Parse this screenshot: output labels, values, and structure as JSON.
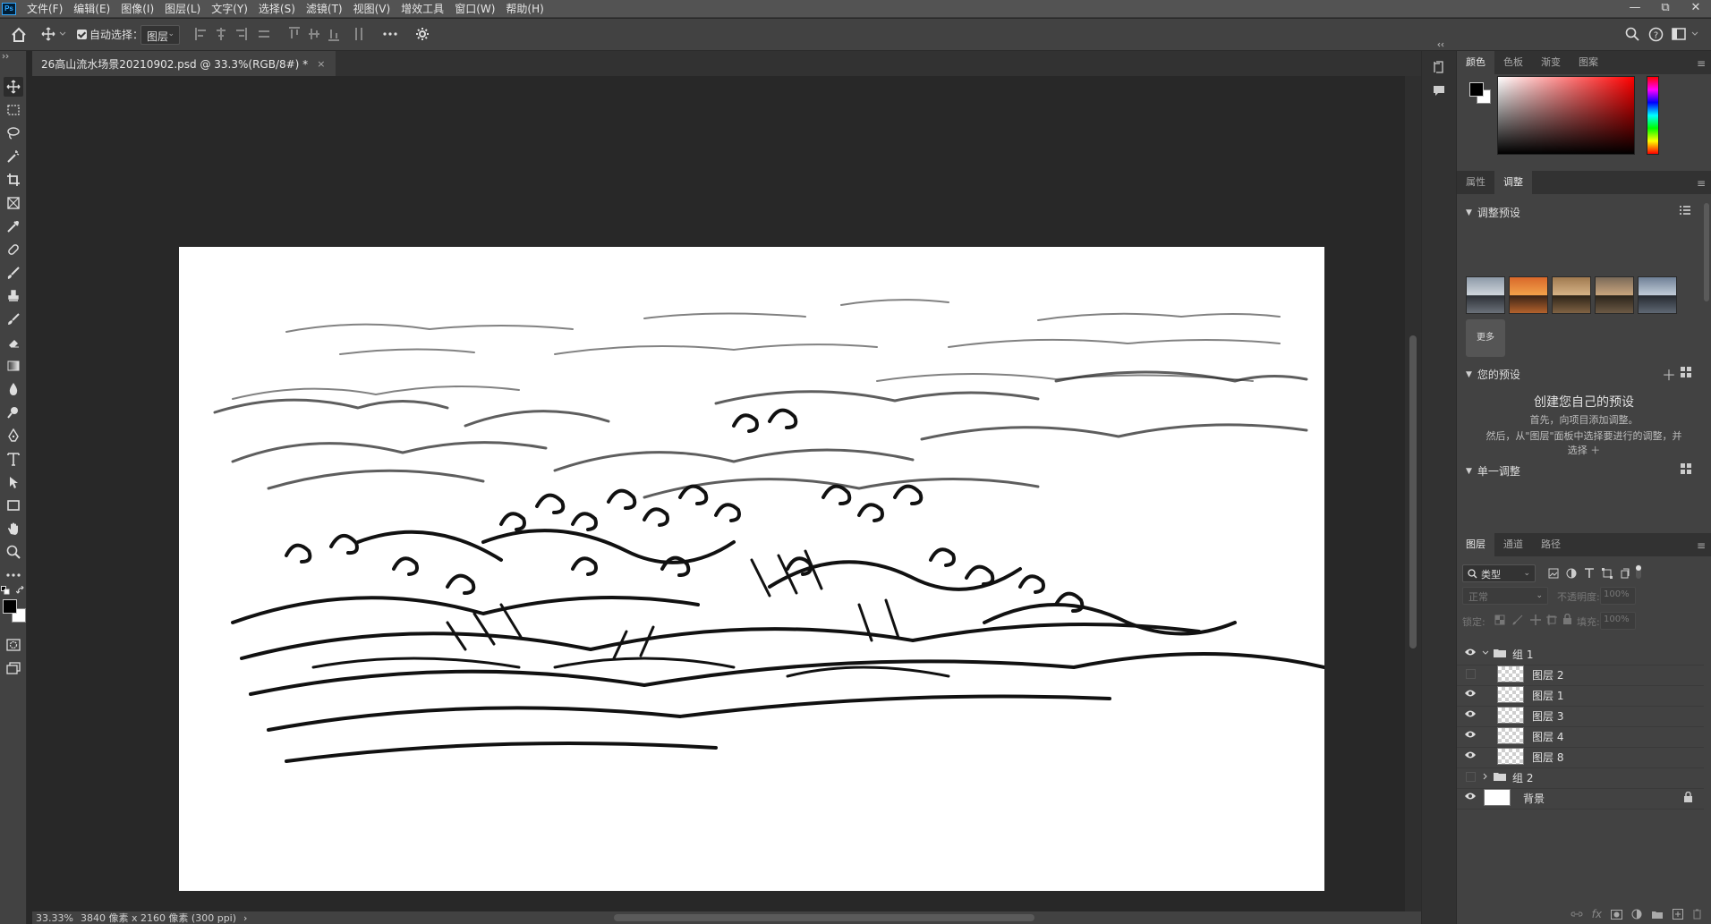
{
  "app": {
    "logo": "Ps",
    "menu": [
      "文件(F)",
      "编辑(E)",
      "图像(I)",
      "图层(L)",
      "文字(Y)",
      "选择(S)",
      "滤镜(T)",
      "视图(V)",
      "增效工具",
      "窗口(W)",
      "帮助(H)"
    ],
    "window_controls": [
      "—",
      "⧉",
      "✕"
    ]
  },
  "options": {
    "auto_select_label": "自动选择：",
    "auto_select_checked": true,
    "target_select": "图层"
  },
  "document": {
    "tab_title": "26高山流水场景20210902.psd @ 33.3%(RGB/8#) *",
    "close_glyph": "×",
    "zoom_status": "33.33%",
    "size_status": "3840 像素 x 2160 像素 (300 ppi)",
    "status_arrow": "›",
    "artwork": "ink-brush-waves-illustration"
  },
  "panels": {
    "color_tabs": [
      "颜色",
      "色板",
      "渐变",
      "图案"
    ],
    "active_color_tab": "颜色",
    "foreground_color": "#000000",
    "background_color": "#ffffff",
    "adjust_tabs": [
      "属性",
      "调整"
    ],
    "active_adjust_tab": "调整",
    "adjust_presets_title": "调整预设",
    "more_label": "更多",
    "your_presets_title": "您的预设",
    "create_title": "创建您自己的预设",
    "create_line1": "首先，向项目添加调整。",
    "create_line2": "然后，从\"图层\"面板中选择要进行的调整，并",
    "create_line3": "选择 ＋",
    "single_adjust_title": "单一调整",
    "layer_tabs": [
      "图层",
      "通道",
      "路径"
    ],
    "active_layer_tab": "图层",
    "filter_type": "类型",
    "blend_mode": "正常",
    "opacity_label": "不透明度:",
    "opacity_value": "100%",
    "lock_label": "锁定:",
    "fill_label": "填充:",
    "fill_value": "100%"
  },
  "layers": [
    {
      "name": "组 1",
      "type": "group",
      "visible": true,
      "expanded": true
    },
    {
      "name": "图层 2",
      "type": "layer",
      "visible": false
    },
    {
      "name": "图层 1",
      "type": "layer",
      "visible": true
    },
    {
      "name": "图层 3",
      "type": "layer",
      "visible": true
    },
    {
      "name": "图层 4",
      "type": "layer",
      "visible": true
    },
    {
      "name": "图层 8",
      "type": "layer",
      "visible": true
    },
    {
      "name": "组 2",
      "type": "group",
      "visible": false,
      "expanded": false
    },
    {
      "name": "背景",
      "type": "background",
      "visible": true,
      "locked": true
    }
  ]
}
